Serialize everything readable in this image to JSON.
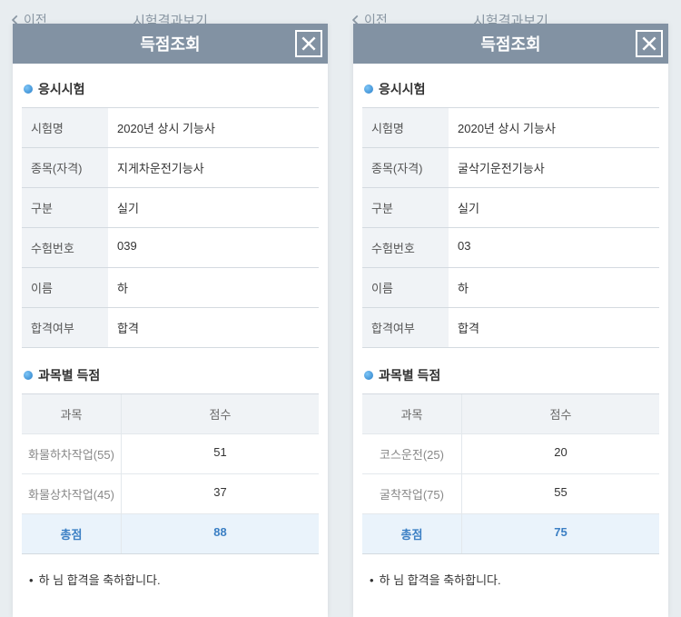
{
  "topbar": {
    "back": "이전",
    "title": "시험결과보기"
  },
  "modal": {
    "title": "득점조회",
    "section_exam": "응시시험",
    "section_score": "과목별 득점",
    "labels": {
      "exam_name": "시험명",
      "subject": "종목(자격)",
      "type": "구분",
      "exam_no": "수험번호",
      "name": "이름",
      "pass": "합격여부"
    },
    "score_head": {
      "subject": "과목",
      "score": "점수"
    },
    "total_label": "총점"
  },
  "screens": [
    {
      "exam": {
        "exam_name": "2020년 상시 기능사",
        "subject": "지게차운전기능사",
        "type": "실기",
        "exam_no": "039",
        "name": "하",
        "pass": "합격"
      },
      "scores": [
        {
          "name": "화물하차작업(55)",
          "score": "51"
        },
        {
          "name": "화물상차작업(45)",
          "score": "37"
        }
      ],
      "total": "88",
      "congrats": "하       님 합격을 축하합니다."
    },
    {
      "exam": {
        "exam_name": "2020년 상시 기능사",
        "subject": "굴삭기운전기능사",
        "type": "실기",
        "exam_no": "03",
        "name": "하",
        "pass": "합격"
      },
      "scores": [
        {
          "name": "코스운전(25)",
          "score": "20"
        },
        {
          "name": "굴착작업(75)",
          "score": "55"
        }
      ],
      "total": "75",
      "congrats": "하       님 합격을 축하합니다."
    }
  ]
}
